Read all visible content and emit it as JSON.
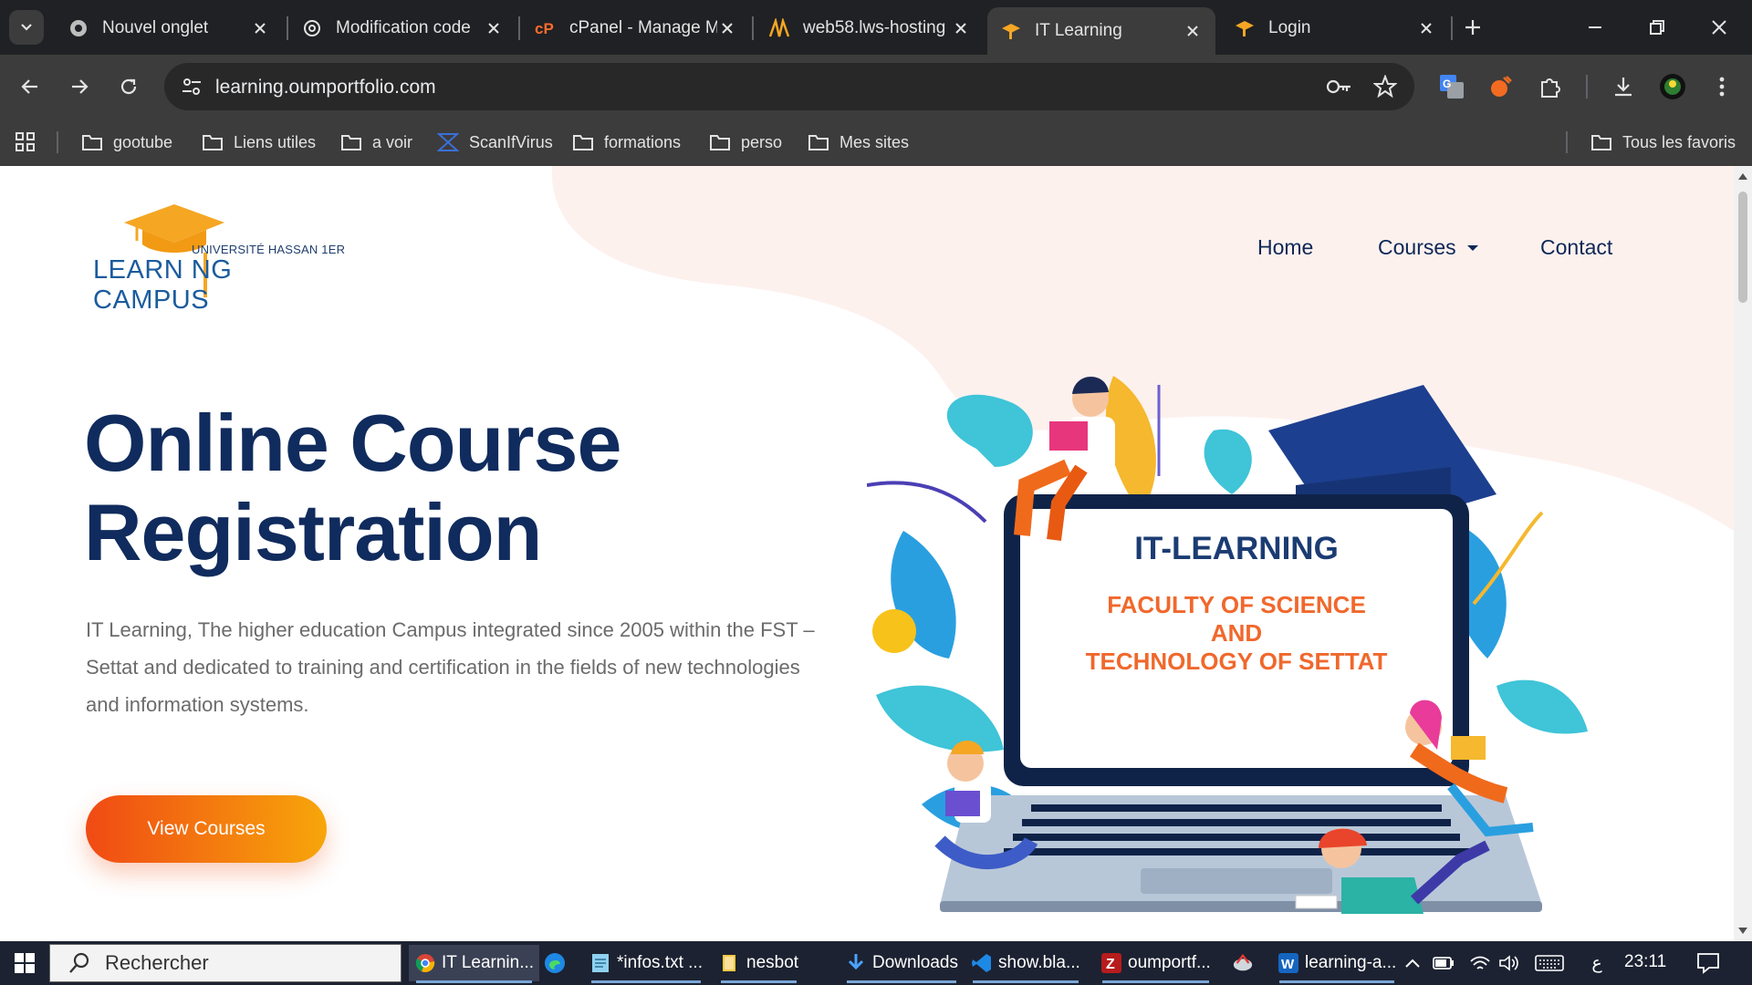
{
  "tabs": [
    {
      "title": "Nouvel onglet",
      "active": false
    },
    {
      "title": "Modification code",
      "active": false
    },
    {
      "title": "cPanel - Manage M",
      "active": false
    },
    {
      "title": "web58.lws-hosting",
      "active": false
    },
    {
      "title": "IT Learning",
      "active": true
    },
    {
      "title": "Login",
      "active": false
    }
  ],
  "toolbar": {
    "url": "learning.oumportfolio.com"
  },
  "bookmarks": [
    "gootube",
    "Liens utiles",
    "a voir",
    "ScanIfVirus",
    "formations",
    "perso",
    "Mes sites"
  ],
  "bookmarks_all": "Tous les favoris",
  "site": {
    "logo_top": "UNIVERSITÉ HASSAN 1ER",
    "logo_main": "LEARN NG CAMPUS",
    "nav": [
      "Home",
      "Courses",
      "Contact"
    ],
    "hero_title_line1": "Online Course",
    "hero_title_line2": "Registration",
    "hero_desc": "IT Learning, The higher education Campus integrated since 2005 within the FST – Settat and dedicated to training and certification in the fields of new technologies and information systems.",
    "cta": "View Courses",
    "laptop_title": "IT-LEARNING",
    "laptop_sub_1": "FACULTY OF SCIENCE",
    "laptop_sub_2": "AND",
    "laptop_sub_3": "TECHNOLOGY OF SETTAT"
  },
  "taskbar": {
    "search": "Rechercher",
    "apps": [
      "IT Learnin...",
      "",
      "*infos.txt ...",
      "nesbot",
      "Downloads",
      "show.bla...",
      "oumportf...",
      "",
      "learning-a..."
    ],
    "lang": "ع",
    "time": "23:11"
  },
  "colors": {
    "brand_navy": "#102b5d",
    "cta_start": "#f04a14",
    "cta_end": "#f7a60a",
    "accent_orange": "#f0682c"
  }
}
